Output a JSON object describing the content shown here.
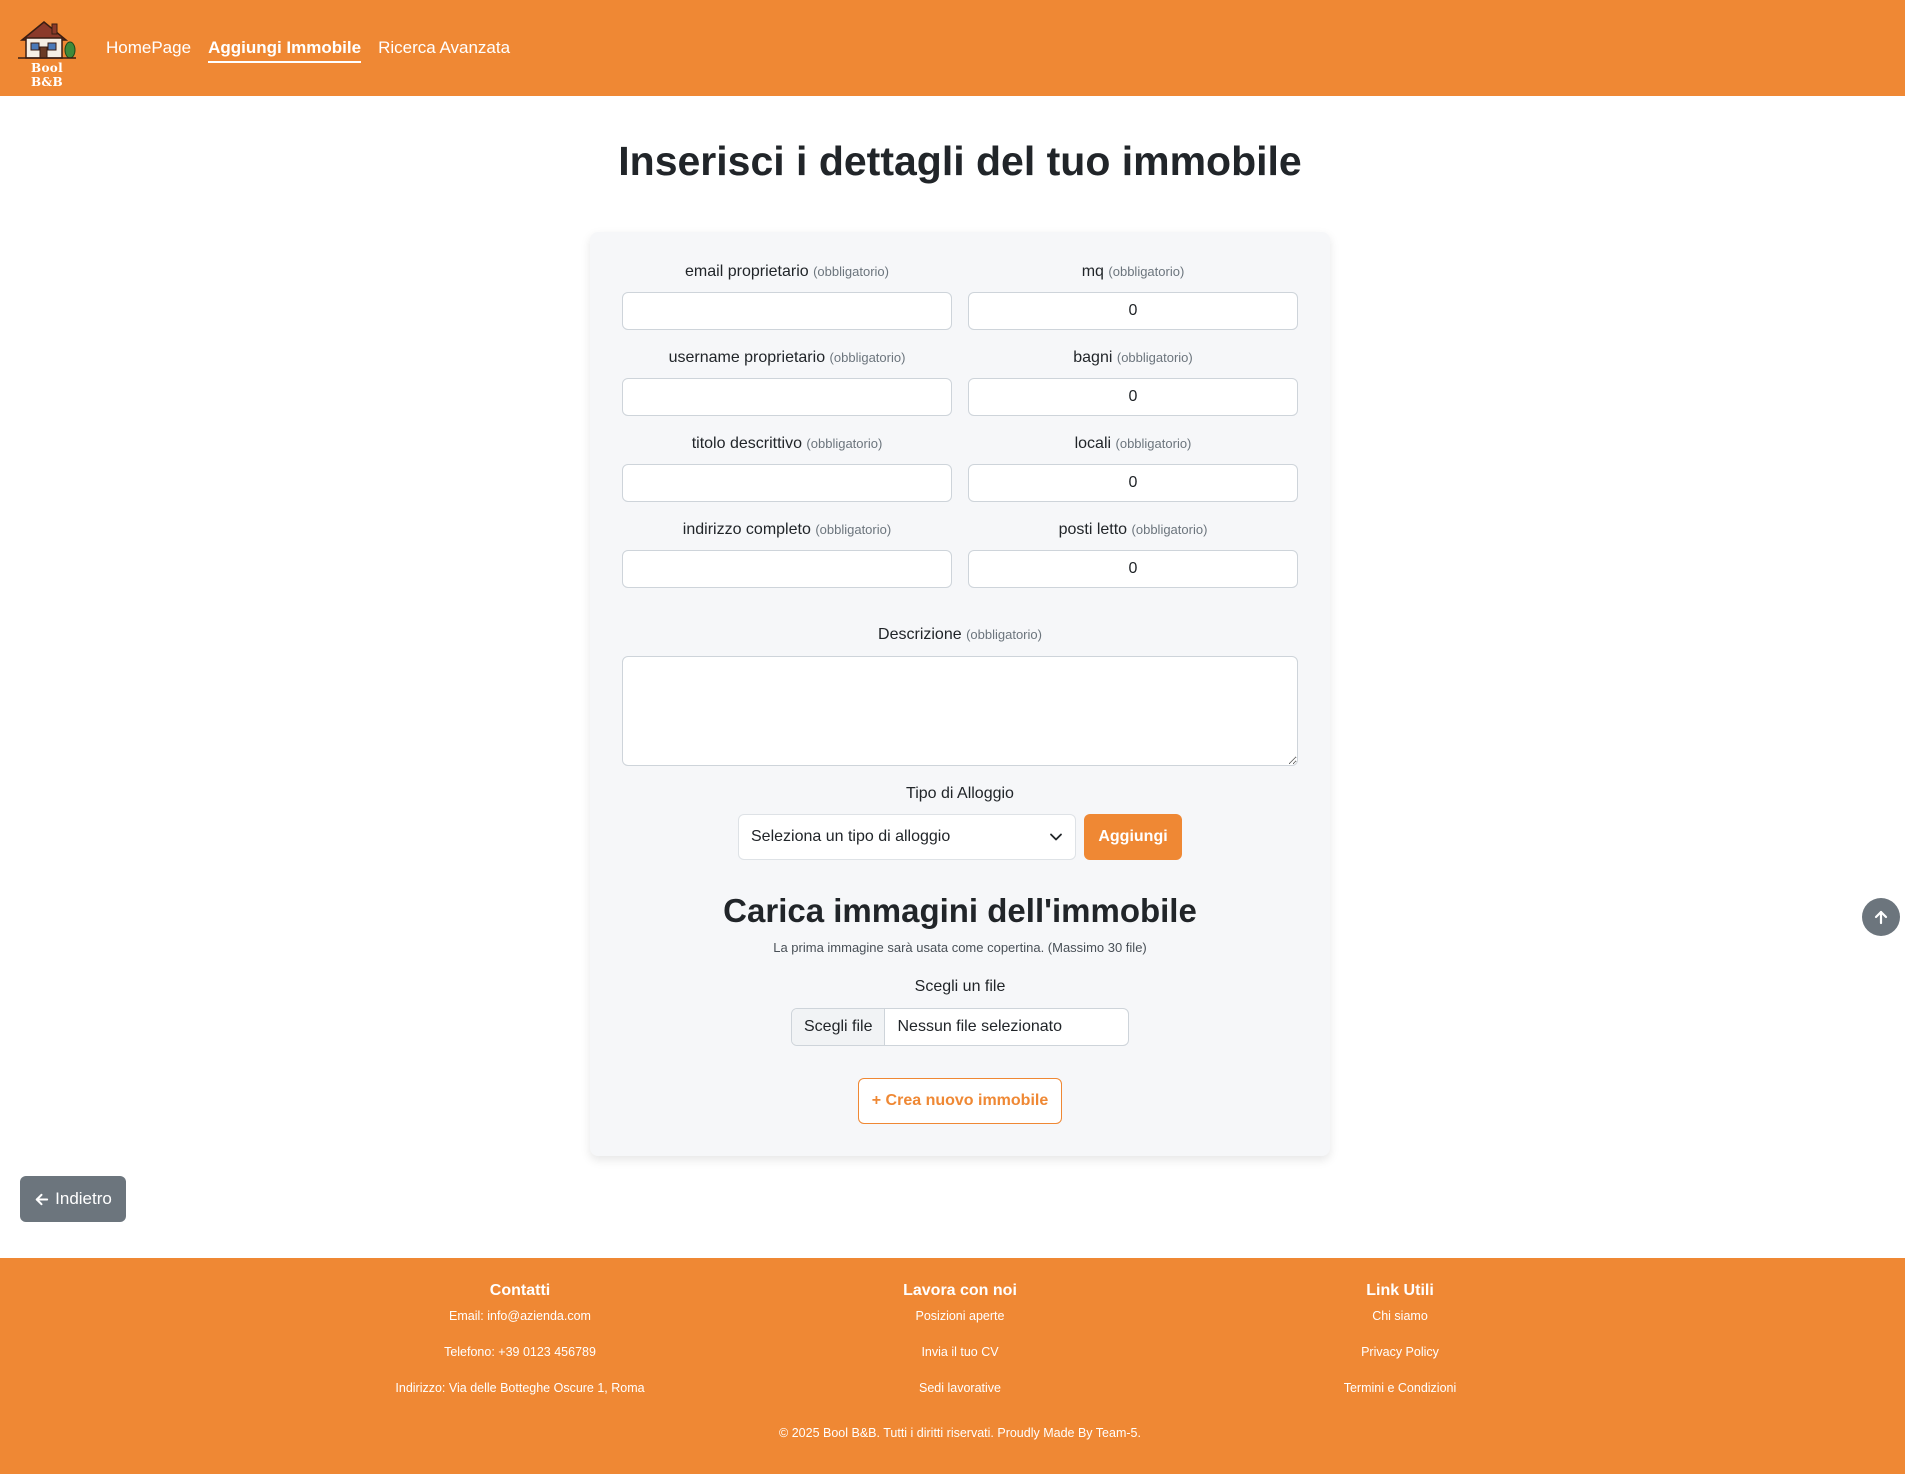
{
  "nav": {
    "brand_text": "Bool B&B",
    "links": [
      {
        "label": "HomePage",
        "active": false
      },
      {
        "label": "Aggiungi Immobile",
        "active": true
      },
      {
        "label": "Ricerca Avanzata",
        "active": false
      }
    ]
  },
  "page": {
    "title": "Inserisci i dettagli del tuo immobile"
  },
  "form": {
    "required_tag": "(obbligatorio)",
    "fields": {
      "email": {
        "label": "email proprietario",
        "value": ""
      },
      "username": {
        "label": "username proprietario",
        "value": ""
      },
      "titolo": {
        "label": "titolo descrittivo",
        "value": ""
      },
      "indirizzo": {
        "label": "indirizzo completo",
        "value": ""
      },
      "mq": {
        "label": "mq",
        "value": "0"
      },
      "bagni": {
        "label": "bagni",
        "value": "0"
      },
      "locali": {
        "label": "locali",
        "value": "0"
      },
      "posti_letto": {
        "label": "posti letto",
        "value": "0"
      }
    },
    "descrizione_label": "Descrizione",
    "tipo_label": "Tipo di Alloggio",
    "tipo_selected": "Seleziona un tipo di alloggio",
    "add_button": "Aggiungi",
    "upload_title": "Carica immagini dell'immobile",
    "upload_subtitle": "La prima immagine sarà usata come copertina. (Massimo 30 file)",
    "file_label": "Scegli un file",
    "file_button": "Scegli file",
    "file_status": "Nessun file selezionato",
    "create_button": "+ Crea nuovo immobile"
  },
  "back_button": "Indietro",
  "footer": {
    "contatti": {
      "title": "Contatti",
      "items": [
        "Email: info@azienda.com",
        "Telefono: +39 0123 456789",
        "Indirizzo: Via delle Botteghe Oscure 1, Roma"
      ]
    },
    "lavora": {
      "title": "Lavora con noi",
      "items": [
        "Posizioni aperte",
        "Invia il tuo CV",
        "Sedi lavorative"
      ]
    },
    "link": {
      "title": "Link Utili",
      "items": [
        "Chi siamo",
        "Privacy Policy",
        "Termini e Condizioni"
      ]
    },
    "copyright": "© 2025 Bool B&B. Tutti i diritti riservati. Proudly Made By Team-5."
  },
  "colors": {
    "brand_orange": "#ef8834",
    "card_bg": "#f6f7f9",
    "secondary_gray": "#6c757d"
  },
  "icons": {
    "logo": "house-logo-icon",
    "select": "chevron-down-icon",
    "back": "arrow-left-icon",
    "scroll_top": "arrow-up-icon"
  }
}
